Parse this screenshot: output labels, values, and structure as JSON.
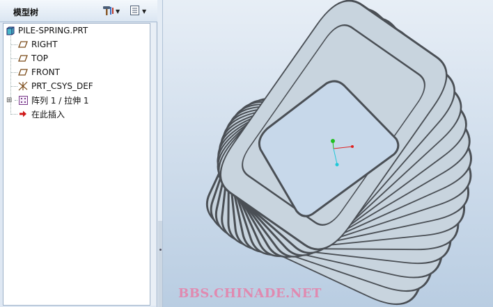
{
  "panel": {
    "title": "模型树",
    "tools": [
      {
        "name": "tree-settings",
        "icon": "hammer-icon"
      },
      {
        "name": "show-options",
        "icon": "list-icon"
      }
    ]
  },
  "tree": {
    "items": [
      {
        "label": "PILE-SPRING.PRT",
        "icon": "part-icon",
        "level": 0,
        "expandable": false
      },
      {
        "label": "RIGHT",
        "icon": "datum-plane-icon",
        "level": 1,
        "expandable": false
      },
      {
        "label": "TOP",
        "icon": "datum-plane-icon",
        "level": 1,
        "expandable": false
      },
      {
        "label": "FRONT",
        "icon": "datum-plane-icon",
        "level": 1,
        "expandable": false
      },
      {
        "label": "PRT_CSYS_DEF",
        "icon": "csys-icon",
        "level": 1,
        "expandable": false
      },
      {
        "label": "阵列 1 / 拉伸 1",
        "icon": "pattern-icon",
        "level": 1,
        "expandable": true
      },
      {
        "label": "在此插入",
        "icon": "insert-arrow-icon",
        "level": 1,
        "expandable": false
      }
    ]
  },
  "viewport": {
    "watermark": "BBS.CHINADE.NET",
    "model_color": "#c8d4de",
    "edge_color": "#4a4f55"
  }
}
